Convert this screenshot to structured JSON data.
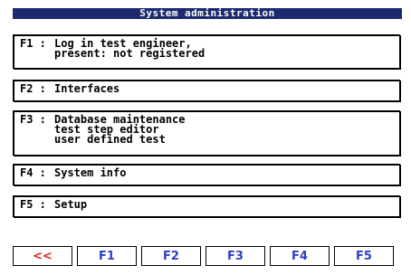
{
  "window": {
    "title": "System administration"
  },
  "menu": [
    {
      "id": "f1",
      "key": "F1 :",
      "lines": [
        "Log in test engineer,",
        "present: not registered"
      ]
    },
    {
      "id": "f2",
      "key": "F2 :",
      "lines": [
        "Interfaces"
      ]
    },
    {
      "id": "f3",
      "key": "F3 :",
      "lines": [
        "Database maintenance",
        "test step editor",
        "user defined test"
      ]
    },
    {
      "id": "f4",
      "key": "F4 :",
      "lines": [
        "System info"
      ]
    },
    {
      "id": "f5",
      "key": "F5 :",
      "lines": [
        "Setup"
      ]
    }
  ],
  "softkeys": [
    {
      "label": "<<",
      "color": "#e02020"
    },
    {
      "label": "F1",
      "color": "#2a3fc8"
    },
    {
      "label": "F2",
      "color": "#2a3fc8"
    },
    {
      "label": "F3",
      "color": "#2a3fc8"
    },
    {
      "label": "F4",
      "color": "#2a3fc8"
    },
    {
      "label": "F5",
      "color": "#2a3fc8"
    }
  ],
  "colors": {
    "titlebar_bg": "#1d2a6e",
    "titlebar_fg": "#ffffff"
  }
}
